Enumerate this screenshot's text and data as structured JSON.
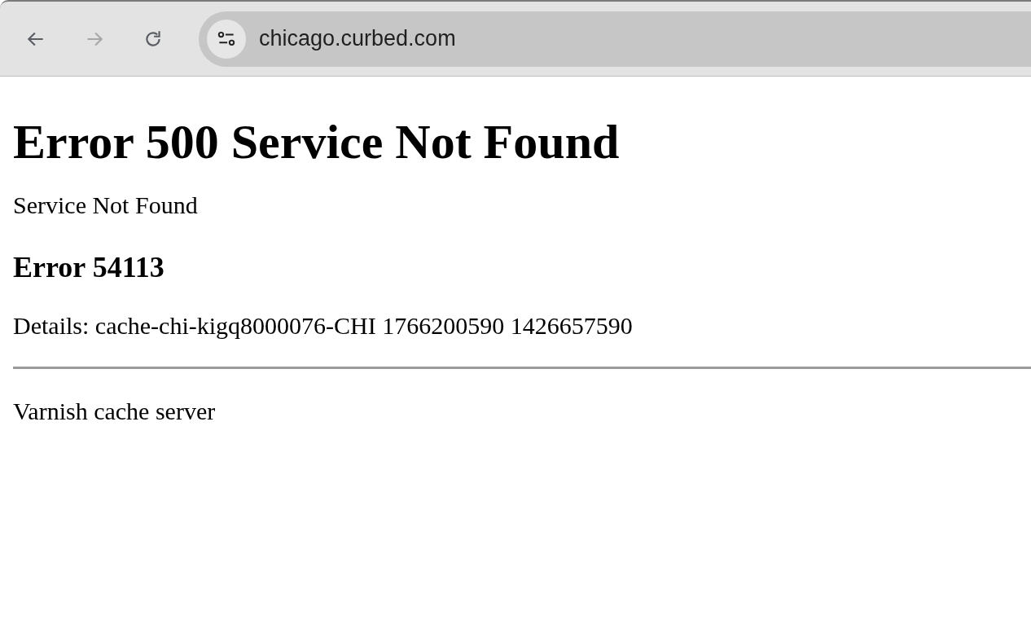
{
  "toolbar": {
    "buttons": [
      {
        "kind": "back",
        "disabled": false
      },
      {
        "kind": "forward",
        "disabled": true
      },
      {
        "kind": "reload",
        "disabled": false
      }
    ],
    "address": "chicago.curbed.com"
  },
  "page": {
    "title": "Error 500 Service Not Found",
    "message": "Service Not Found",
    "error_code": "Error 54113",
    "details": "Details: cache-chi-kigq8000076-CHI 1766200590 1426657590",
    "footer": "Varnish cache server"
  }
}
